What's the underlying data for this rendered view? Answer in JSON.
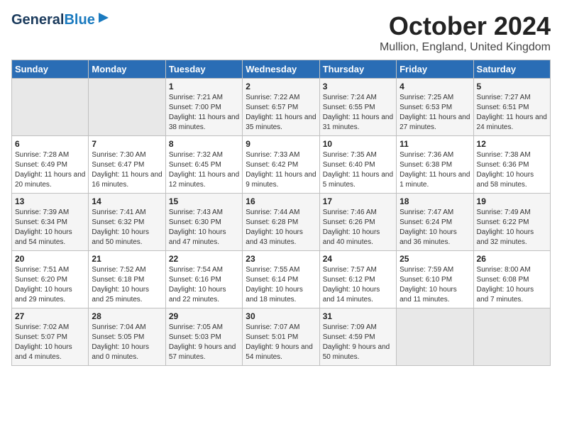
{
  "header": {
    "logo_general": "General",
    "logo_blue": "Blue",
    "month_title": "October 2024",
    "location": "Mullion, England, United Kingdom"
  },
  "weekdays": [
    "Sunday",
    "Monday",
    "Tuesday",
    "Wednesday",
    "Thursday",
    "Friday",
    "Saturday"
  ],
  "weeks": [
    [
      {
        "day": "",
        "sunrise": "",
        "sunset": "",
        "daylight": ""
      },
      {
        "day": "",
        "sunrise": "",
        "sunset": "",
        "daylight": ""
      },
      {
        "day": "1",
        "sunrise": "Sunrise: 7:21 AM",
        "sunset": "Sunset: 7:00 PM",
        "daylight": "Daylight: 11 hours and 38 minutes."
      },
      {
        "day": "2",
        "sunrise": "Sunrise: 7:22 AM",
        "sunset": "Sunset: 6:57 PM",
        "daylight": "Daylight: 11 hours and 35 minutes."
      },
      {
        "day": "3",
        "sunrise": "Sunrise: 7:24 AM",
        "sunset": "Sunset: 6:55 PM",
        "daylight": "Daylight: 11 hours and 31 minutes."
      },
      {
        "day": "4",
        "sunrise": "Sunrise: 7:25 AM",
        "sunset": "Sunset: 6:53 PM",
        "daylight": "Daylight: 11 hours and 27 minutes."
      },
      {
        "day": "5",
        "sunrise": "Sunrise: 7:27 AM",
        "sunset": "Sunset: 6:51 PM",
        "daylight": "Daylight: 11 hours and 24 minutes."
      }
    ],
    [
      {
        "day": "6",
        "sunrise": "Sunrise: 7:28 AM",
        "sunset": "Sunset: 6:49 PM",
        "daylight": "Daylight: 11 hours and 20 minutes."
      },
      {
        "day": "7",
        "sunrise": "Sunrise: 7:30 AM",
        "sunset": "Sunset: 6:47 PM",
        "daylight": "Daylight: 11 hours and 16 minutes."
      },
      {
        "day": "8",
        "sunrise": "Sunrise: 7:32 AM",
        "sunset": "Sunset: 6:45 PM",
        "daylight": "Daylight: 11 hours and 12 minutes."
      },
      {
        "day": "9",
        "sunrise": "Sunrise: 7:33 AM",
        "sunset": "Sunset: 6:42 PM",
        "daylight": "Daylight: 11 hours and 9 minutes."
      },
      {
        "day": "10",
        "sunrise": "Sunrise: 7:35 AM",
        "sunset": "Sunset: 6:40 PM",
        "daylight": "Daylight: 11 hours and 5 minutes."
      },
      {
        "day": "11",
        "sunrise": "Sunrise: 7:36 AM",
        "sunset": "Sunset: 6:38 PM",
        "daylight": "Daylight: 11 hours and 1 minute."
      },
      {
        "day": "12",
        "sunrise": "Sunrise: 7:38 AM",
        "sunset": "Sunset: 6:36 PM",
        "daylight": "Daylight: 10 hours and 58 minutes."
      }
    ],
    [
      {
        "day": "13",
        "sunrise": "Sunrise: 7:39 AM",
        "sunset": "Sunset: 6:34 PM",
        "daylight": "Daylight: 10 hours and 54 minutes."
      },
      {
        "day": "14",
        "sunrise": "Sunrise: 7:41 AM",
        "sunset": "Sunset: 6:32 PM",
        "daylight": "Daylight: 10 hours and 50 minutes."
      },
      {
        "day": "15",
        "sunrise": "Sunrise: 7:43 AM",
        "sunset": "Sunset: 6:30 PM",
        "daylight": "Daylight: 10 hours and 47 minutes."
      },
      {
        "day": "16",
        "sunrise": "Sunrise: 7:44 AM",
        "sunset": "Sunset: 6:28 PM",
        "daylight": "Daylight: 10 hours and 43 minutes."
      },
      {
        "day": "17",
        "sunrise": "Sunrise: 7:46 AM",
        "sunset": "Sunset: 6:26 PM",
        "daylight": "Daylight: 10 hours and 40 minutes."
      },
      {
        "day": "18",
        "sunrise": "Sunrise: 7:47 AM",
        "sunset": "Sunset: 6:24 PM",
        "daylight": "Daylight: 10 hours and 36 minutes."
      },
      {
        "day": "19",
        "sunrise": "Sunrise: 7:49 AM",
        "sunset": "Sunset: 6:22 PM",
        "daylight": "Daylight: 10 hours and 32 minutes."
      }
    ],
    [
      {
        "day": "20",
        "sunrise": "Sunrise: 7:51 AM",
        "sunset": "Sunset: 6:20 PM",
        "daylight": "Daylight: 10 hours and 29 minutes."
      },
      {
        "day": "21",
        "sunrise": "Sunrise: 7:52 AM",
        "sunset": "Sunset: 6:18 PM",
        "daylight": "Daylight: 10 hours and 25 minutes."
      },
      {
        "day": "22",
        "sunrise": "Sunrise: 7:54 AM",
        "sunset": "Sunset: 6:16 PM",
        "daylight": "Daylight: 10 hours and 22 minutes."
      },
      {
        "day": "23",
        "sunrise": "Sunrise: 7:55 AM",
        "sunset": "Sunset: 6:14 PM",
        "daylight": "Daylight: 10 hours and 18 minutes."
      },
      {
        "day": "24",
        "sunrise": "Sunrise: 7:57 AM",
        "sunset": "Sunset: 6:12 PM",
        "daylight": "Daylight: 10 hours and 14 minutes."
      },
      {
        "day": "25",
        "sunrise": "Sunrise: 7:59 AM",
        "sunset": "Sunset: 6:10 PM",
        "daylight": "Daylight: 10 hours and 11 minutes."
      },
      {
        "day": "26",
        "sunrise": "Sunrise: 8:00 AM",
        "sunset": "Sunset: 6:08 PM",
        "daylight": "Daylight: 10 hours and 7 minutes."
      }
    ],
    [
      {
        "day": "27",
        "sunrise": "Sunrise: 7:02 AM",
        "sunset": "Sunset: 5:07 PM",
        "daylight": "Daylight: 10 hours and 4 minutes."
      },
      {
        "day": "28",
        "sunrise": "Sunrise: 7:04 AM",
        "sunset": "Sunset: 5:05 PM",
        "daylight": "Daylight: 10 hours and 0 minutes."
      },
      {
        "day": "29",
        "sunrise": "Sunrise: 7:05 AM",
        "sunset": "Sunset: 5:03 PM",
        "daylight": "Daylight: 9 hours and 57 minutes."
      },
      {
        "day": "30",
        "sunrise": "Sunrise: 7:07 AM",
        "sunset": "Sunset: 5:01 PM",
        "daylight": "Daylight: 9 hours and 54 minutes."
      },
      {
        "day": "31",
        "sunrise": "Sunrise: 7:09 AM",
        "sunset": "Sunset: 4:59 PM",
        "daylight": "Daylight: 9 hours and 50 minutes."
      },
      {
        "day": "",
        "sunrise": "",
        "sunset": "",
        "daylight": ""
      },
      {
        "day": "",
        "sunrise": "",
        "sunset": "",
        "daylight": ""
      }
    ]
  ]
}
